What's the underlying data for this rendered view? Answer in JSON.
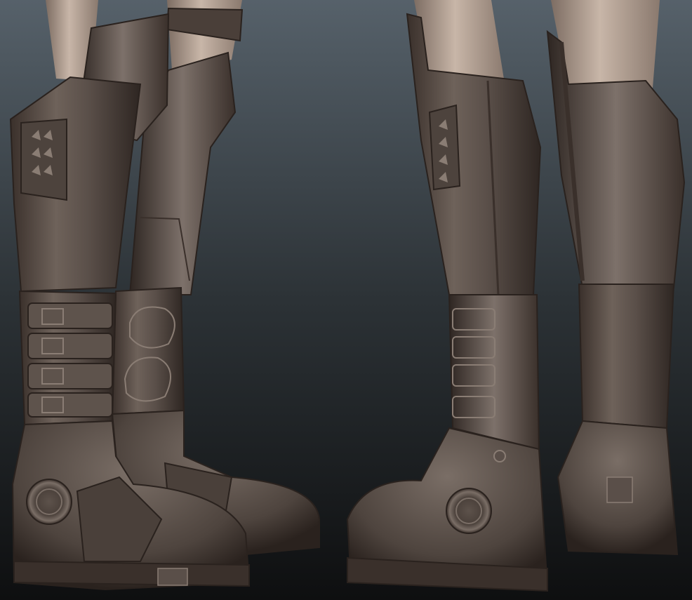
{
  "scene": {
    "subject": "sculpted-boots-render",
    "views": [
      "front-three-quarter-view",
      "rear-three-quarter-view"
    ],
    "colors": {
      "bg_top": "#56616a",
      "bg_mid": "#2c3236",
      "bg_bottom": "#0e0f10",
      "leather_light": "#7a6e66",
      "leather_mid": "#5a4f49",
      "leather_dark": "#2e2622",
      "skin": "#b9a79a",
      "skin_shadow": "#7d6d63"
    }
  }
}
